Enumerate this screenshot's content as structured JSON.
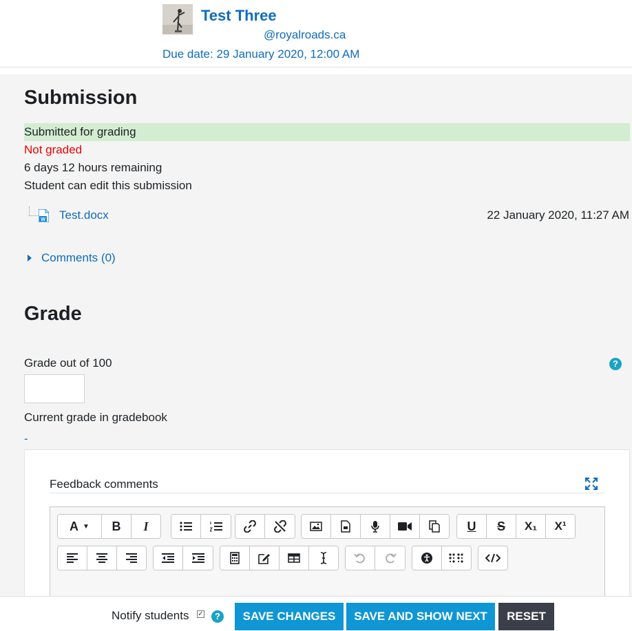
{
  "header": {
    "student_name": "Test Three",
    "student_email": "@royalroads.ca",
    "due_date": "Due date: 29 January 2020, 12:00 AM"
  },
  "submission": {
    "heading": "Submission",
    "status_submitted": "Submitted for grading",
    "status_grading": "Not graded",
    "time_remaining": "6 days 12 hours remaining",
    "edit_status": "Student can edit this submission",
    "file": {
      "name": "Test.docx",
      "date": "22 January 2020, 11:27 AM",
      "icon": "word-doc-icon"
    },
    "comments_label": "Comments (0)"
  },
  "grade": {
    "heading": "Grade",
    "grade_label": "Grade out of 100",
    "grade_value": "",
    "gradebook_label": "Current grade in gradebook",
    "gradebook_value": "-"
  },
  "feedback": {
    "label": "Feedback comments",
    "toolbar": {
      "font_label": "A",
      "bold": "B",
      "italic": "I",
      "subscript": "X₁",
      "superscript": "X¹"
    }
  },
  "footer": {
    "notify_label": "Notify students",
    "notify_checked": true,
    "notify_check_glyph": "✓",
    "save_changes": "SAVE CHANGES",
    "save_next": "SAVE AND SHOW NEXT",
    "reset": "RESET"
  },
  "colors": {
    "link": "#0f6cbf",
    "accent_button": "#0f96d4",
    "dark_button": "#3a3f4a",
    "success_bg": "#d3edd0",
    "error_text": "#ee0000",
    "help": "#1aa3c4"
  }
}
